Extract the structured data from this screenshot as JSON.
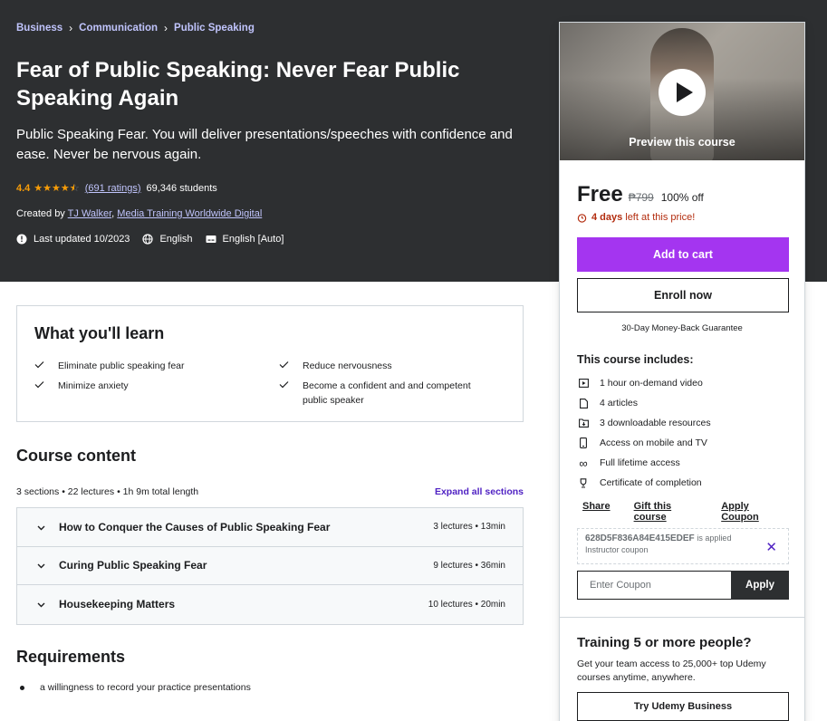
{
  "breadcrumb": [
    "Business",
    "Communication",
    "Public Speaking"
  ],
  "course": {
    "title": "Fear of Public Speaking: Never Fear Public Speaking Again",
    "subtitle": "Public Speaking Fear. You will deliver presentations/speeches with confidence and ease. Never be nervous again.",
    "rating": "4.4",
    "stars": 4.4,
    "ratings_link": "(691 ratings)",
    "students": "69,346 students",
    "created_by_label": "Created by",
    "instructors": [
      "TJ Walker",
      "Media Training Worldwide Digital"
    ],
    "last_updated": "Last updated 10/2023",
    "language": "English",
    "captions": "English [Auto]"
  },
  "card": {
    "preview_label": "Preview this course",
    "price": "Free",
    "original_price": "₱799",
    "discount": "100% off",
    "timer_days": "4 days",
    "timer_rest": "left at this price!",
    "add_to_cart": "Add to cart",
    "enroll_now": "Enroll now",
    "guarantee": "30-Day Money-Back Guarantee",
    "includes_title": "This course includes:",
    "includes": [
      {
        "icon": "video-icon",
        "label": "1 hour on-demand video"
      },
      {
        "icon": "article-icon",
        "label": "4 articles"
      },
      {
        "icon": "download-folder-icon",
        "label": "3 downloadable resources"
      },
      {
        "icon": "mobile-icon",
        "label": "Access on mobile and TV"
      },
      {
        "icon": "infinity-icon",
        "label": "Full lifetime access"
      },
      {
        "icon": "trophy-icon",
        "label": "Certificate of completion"
      }
    ],
    "links": [
      "Share",
      "Gift this course",
      "Apply Coupon"
    ],
    "coupon_code": "628D5F836A84E415EDEF",
    "coupon_applied": "is applied",
    "coupon_sub": "Instructor coupon",
    "coupon_placeholder": "Enter Coupon",
    "apply": "Apply",
    "business_title": "Training 5 or more people?",
    "business_text": "Get your team access to 25,000+ top Udemy courses anytime, anywhere.",
    "business_button": "Try Udemy Business"
  },
  "learn": {
    "title": "What you'll learn",
    "items": [
      "Eliminate public speaking fear",
      "Reduce nervousness",
      "Minimize anxiety",
      "Become a confident and and competent public speaker"
    ]
  },
  "content": {
    "title": "Course content",
    "meta": "3 sections • 22 lectures • 1h 9m total length",
    "expand_all": "Expand all sections",
    "sections": [
      {
        "title": "How to Conquer the Causes of Public Speaking Fear",
        "meta": "3 lectures • 13min"
      },
      {
        "title": "Curing Public Speaking Fear",
        "meta": "9 lectures • 36min"
      },
      {
        "title": "Housekeeping Matters",
        "meta": "10 lectures • 20min"
      }
    ]
  },
  "requirements": {
    "title": "Requirements",
    "items": [
      "a willingness to record your practice presentations"
    ]
  },
  "colors": {
    "hero_bg": "#2d2f31",
    "purple": "#a435f0",
    "link_purple": "#5022c3",
    "star": "#f69c08",
    "timer_red": "#b32d0f"
  }
}
